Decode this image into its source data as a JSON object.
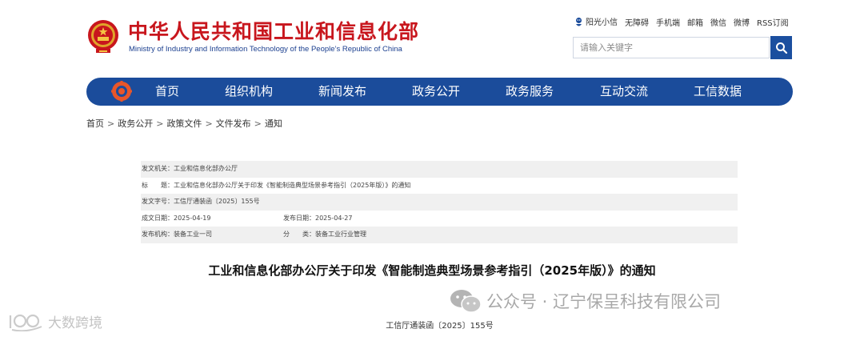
{
  "header": {
    "site_title": "中华人民共和国工业和信息化部",
    "site_subtitle": "Ministry of Industry and Information Technology of the People’s Republic of China",
    "emblem_icon": "national-emblem-icon",
    "brand_color": "#c8161d",
    "accent_color": "#1b4c9b"
  },
  "top_links": [
    "阳光小信",
    "无障碍",
    "手机端",
    "邮箱",
    "微信",
    "微博",
    "RSS订阅"
  ],
  "search": {
    "placeholder": "请输入关键字",
    "button_icon": "search-icon"
  },
  "nav": {
    "logo_icon": "ministry-logo-icon",
    "items": [
      "首页",
      "组织机构",
      "新闻发布",
      "政务公开",
      "政务服务",
      "互动交流",
      "工信数据"
    ]
  },
  "breadcrumb": [
    "首页",
    "政务公开",
    "政策文件",
    "文件发布",
    "通知"
  ],
  "info": {
    "issuer": "发文机关：工业和信息化部办公厅",
    "title": "标　　题：工业和信息化部办公厅关于印发《智能制造典型场景参考指引（2025年版）》的通知",
    "doc_number": "发文字号：工信厅通装函〔2025〕155号",
    "written_date": "成文日期：2025-04-19",
    "publish_date": "发布日期：2025-04-27",
    "publisher": "发布机构：装备工业一司",
    "category": "分　　类：装备工业行业管理"
  },
  "document": {
    "title": "工业和信息化部办公厅关于印发《智能制造典型场景参考指引（2025年版）》的通知",
    "number": "工信厅通装函〔2025〕155号"
  },
  "watermarks": {
    "right": "公众号 · 辽宁保呈科技有限公司",
    "left": "大数跨境"
  }
}
